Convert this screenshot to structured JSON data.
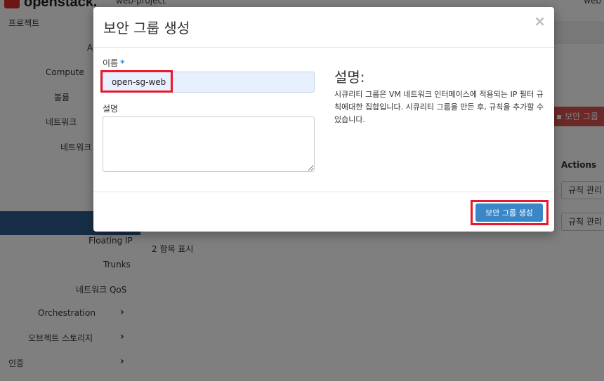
{
  "topbar": {
    "logo_text": "openstack.",
    "project": "web-project",
    "user": "web"
  },
  "sidebar": {
    "items": [
      {
        "label": "프로젝트"
      },
      {
        "label": "A"
      },
      {
        "label": "Compute"
      },
      {
        "label": "볼륨"
      },
      {
        "label": "네트워크"
      },
      {
        "label": "네트워크"
      },
      {
        "label": "Floating IP"
      },
      {
        "label": "Trunks"
      },
      {
        "label": "네트워크 QoS"
      },
      {
        "label": "Orchestration",
        "chevron": "›"
      },
      {
        "label": "오브젝트 스토리지",
        "chevron": "›"
      },
      {
        "label": "인증",
        "chevron": "›"
      }
    ]
  },
  "main": {
    "create_button_label": "보안 그룹",
    "actions_header": "Actions",
    "row_actions": [
      "규칙 관리",
      "규칙 관리"
    ],
    "count_text": "2 항목 표시"
  },
  "modal": {
    "title": "보안 그룹 생성",
    "close_label": "×",
    "name_label": "이름",
    "name_required": "*",
    "name_value": "open-sg-web",
    "desc_label": "설명",
    "desc_value": "",
    "help_title": "설명:",
    "help_text": "시큐리티 그룹은 VM 네트워크 인터페이스에 적용되는 IP 필터 규칙에대한 집합입니다. 시큐리티 그룹을 만든 후, 규칙을 추가할 수 있습니다.",
    "submit_label": "보안 그룹 생성"
  },
  "colors": {
    "primary": "#3a87c8",
    "danger": "#d9534f",
    "highlight": "#e8192c",
    "sidebar_active": "#2f5f8c"
  }
}
